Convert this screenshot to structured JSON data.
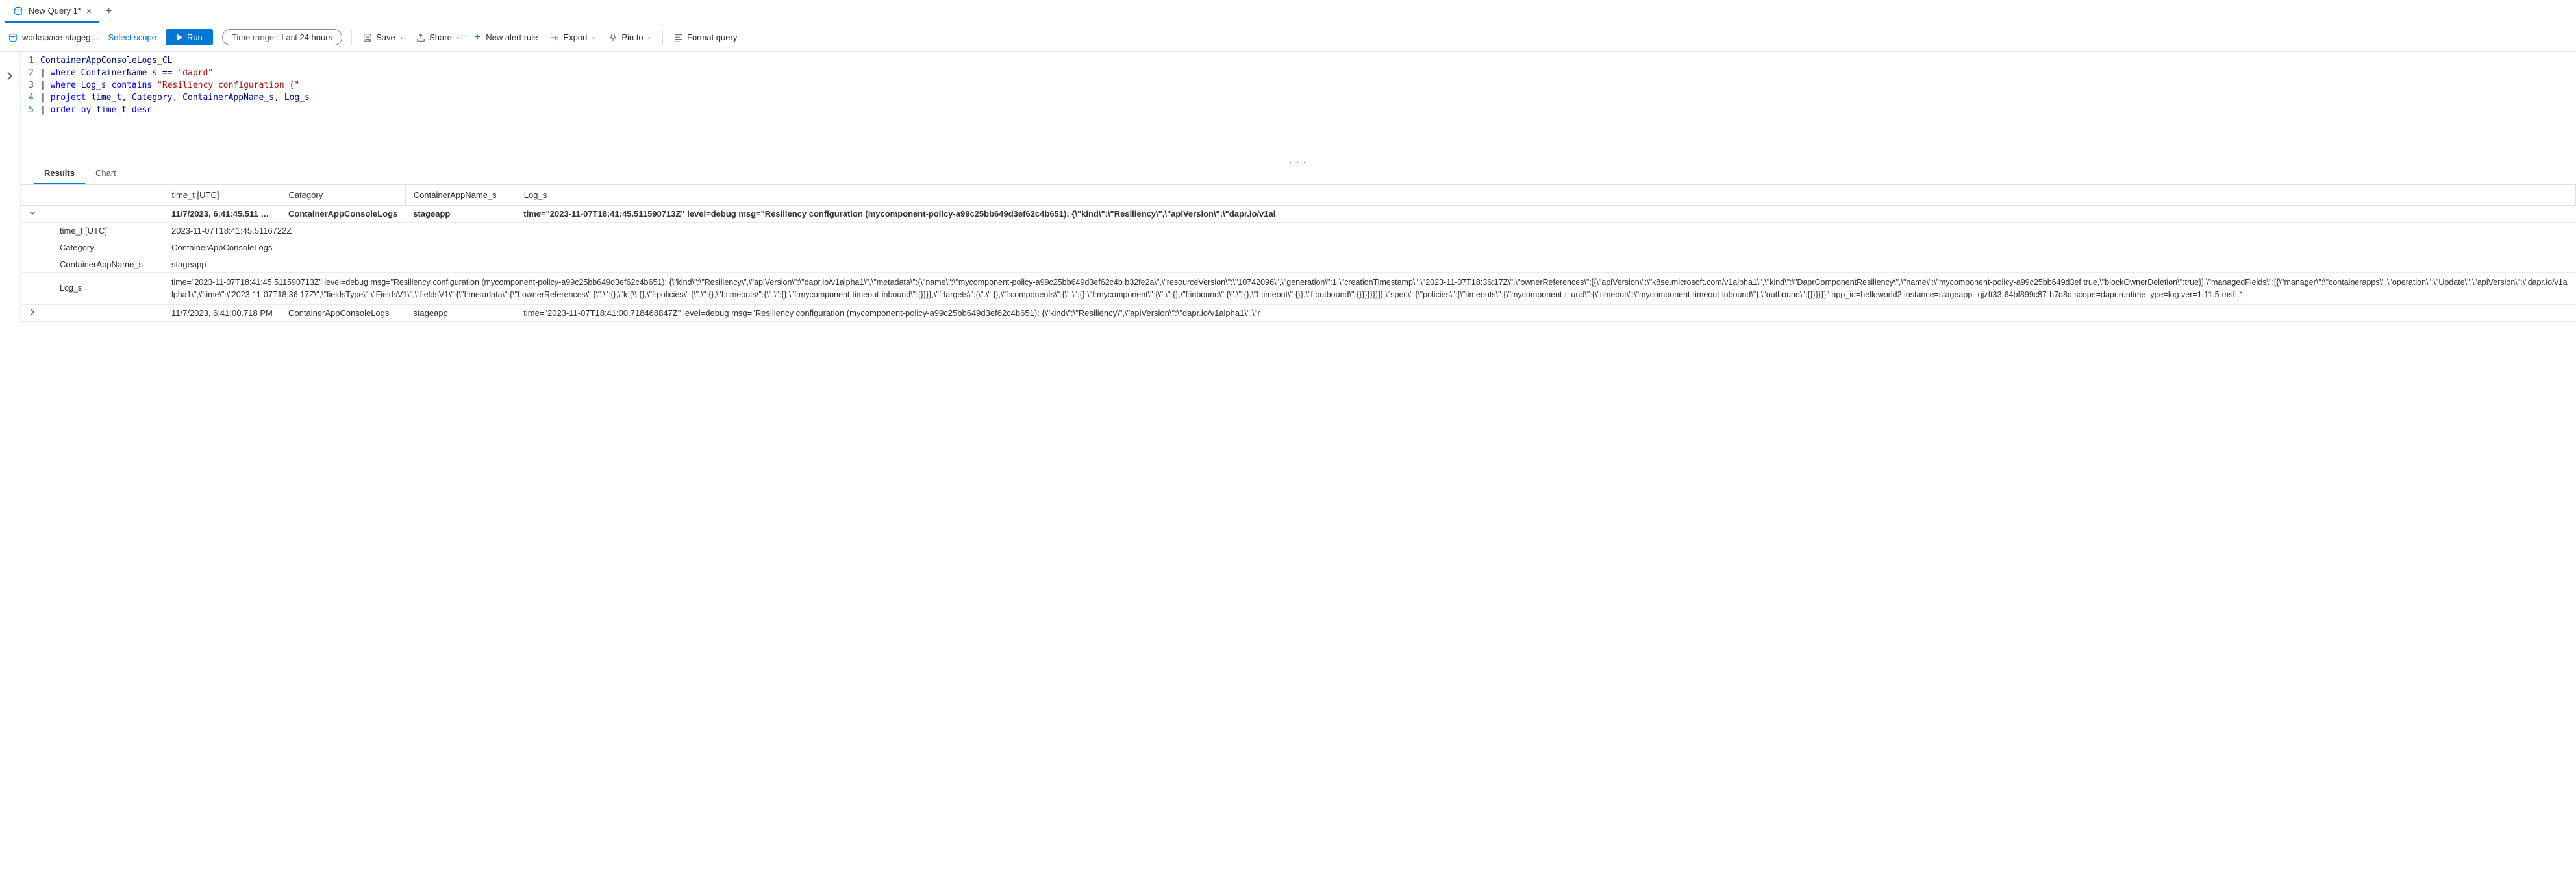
{
  "tab": {
    "title": "New Query 1*"
  },
  "toolbar": {
    "workspace": "workspace-stageg…",
    "scope_link": "Select scope",
    "run": "Run",
    "time_range_label": "Time range :",
    "time_range_value": "Last 24 hours",
    "save": "Save",
    "share": "Share",
    "new_alert": "New alert rule",
    "export": "Export",
    "pin": "Pin to",
    "format": "Format query"
  },
  "editor": {
    "lines": [
      {
        "num": "1",
        "parts": [
          {
            "t": "ContainerAppConsoleLogs_CL",
            "c": "tbl"
          }
        ]
      },
      {
        "num": "2",
        "parts": [
          {
            "t": "| ",
            "c": ""
          },
          {
            "t": "where",
            "c": "kw"
          },
          {
            "t": " ContainerName_s == ",
            "c": "col"
          },
          {
            "t": "\"daprd\"",
            "c": "str"
          }
        ]
      },
      {
        "num": "3",
        "parts": [
          {
            "t": "| ",
            "c": ""
          },
          {
            "t": "where",
            "c": "kw"
          },
          {
            "t": " Log_s ",
            "c": "col"
          },
          {
            "t": "contains",
            "c": "kw"
          },
          {
            "t": " ",
            "c": ""
          },
          {
            "t": "\"Resiliency configuration (\"",
            "c": "str"
          }
        ]
      },
      {
        "num": "4",
        "parts": [
          {
            "t": "| ",
            "c": ""
          },
          {
            "t": "project",
            "c": "kw"
          },
          {
            "t": " time_t, Category, ContainerAppName_s, Log_s",
            "c": "col"
          }
        ]
      },
      {
        "num": "5",
        "parts": [
          {
            "t": "| ",
            "c": ""
          },
          {
            "t": "order by",
            "c": "kw"
          },
          {
            "t": " time_t ",
            "c": "col"
          },
          {
            "t": "desc",
            "c": "kw"
          }
        ]
      }
    ]
  },
  "results": {
    "tabs": {
      "results": "Results",
      "chart": "Chart"
    },
    "columns": [
      "time_t [UTC]",
      "Category",
      "ContainerAppName_s",
      "Log_s"
    ],
    "row1": {
      "time": "11/7/2023, 6:41:45.511 …",
      "category": "ContainerAppConsoleLogs",
      "app": "stageapp",
      "log": "time=\"2023-11-07T18:41:45.511590713Z\" level=debug msg=\"Resiliency configuration (mycomponent-policy-a99c25bb649d3ef62c4b651): {\\\"kind\\\":\\\"Resiliency\\\",\\\"apiVersion\\\":\\\"dapr.io/v1al"
    },
    "detail": {
      "time_label": "time_t [UTC]",
      "time_value": "2023-11-07T18:41:45.5116722Z",
      "category_label": "Category",
      "category_value": "ContainerAppConsoleLogs",
      "app_label": "ContainerAppName_s",
      "app_value": "stageapp",
      "log_label": "Log_s",
      "log_value": "time=\"2023-11-07T18:41:45.511590713Z\" level=debug msg=\"Resiliency configuration (mycomponent-policy-a99c25bb649d3ef62c4b651): {\\\"kind\\\":\\\"Resiliency\\\",\\\"apiVersion\\\":\\\"dapr.io/v1alpha1\\\",\\\"metadata\\\":{\\\"name\\\":\\\"mycomponent-policy-a99c25bb649d3ef62c4b b32fe2a\\\",\\\"resourceVersion\\\":\\\"10742096\\\",\\\"generation\\\":1,\\\"creationTimestamp\\\":\\\"2023-11-07T18:36:17Z\\\",\\\"ownerReferences\\\":[{\\\"apiVersion\\\":\\\"k8se.microsoft.com/v1alpha1\\\",\\\"kind\\\":\\\"DaprComponentResiliency\\\",\\\"name\\\":\\\"mycomponent-policy-a99c25bb649d3ef true,\\\"blockOwnerDeletion\\\":true}],\\\"managedFields\\\":[{\\\"manager\\\":\\\"containerapps\\\",\\\"operation\\\":\\\"Update\\\",\\\"apiVersion\\\":\\\"dapr.io/v1alpha1\\\",\\\"time\\\":\\\"2023-11-07T18:36:17Z\\\",\\\"fieldsType\\\":\\\"FieldsV1\\\",\\\"fieldsV1\\\":{\\\"f:metadata\\\":{\\\"f:ownerReferences\\\":{\\\".\\\":{},\\\"k:{\\\\ {},\\\"f:policies\\\":{\\\".\\\":{},\\\"f:timeouts\\\":{\\\".\\\":{},\\\"f:mycomponent-timeout-inbound\\\":{}}}},\\\"f:targets\\\":{\\\".\\\":{},\\\"f:components\\\":{\\\".\\\":{},\\\"f:mycomponent\\\":{\\\".\\\":{},\\\"f:inbound\\\":{\\\".\\\":{},\\\"f:timeout\\\":{}},\\\"f:outbound\\\":{}}}}}}}]},\\\"spec\\\":{\\\"policies\\\":{\\\"timeouts\\\":{\\\"mycomponent-ti und\\\":{\\\"timeout\\\":\\\"mycomponent-timeout-inbound\\\"},\\\"outbound\\\":{}}}}}}\" app_id=helloworld2 instance=stageapp--qjzft33-64bf899c87-h7d8q scope=dapr.runtime type=log ver=1.11.5-msft.1"
    },
    "row2": {
      "time": "11/7/2023, 6:41:00.718 PM",
      "category": "ContainerAppConsoleLogs",
      "app": "stageapp",
      "log": "time=\"2023-11-07T18:41:00.718468847Z\" level=debug msg=\"Resiliency configuration (mycomponent-policy-a99c25bb649d3ef62c4b651): {\\\"kind\\\":\\\"Resiliency\\\",\\\"apiVersion\\\":\\\"dapr.io/v1alpha1\\\",\\\"r"
    }
  }
}
